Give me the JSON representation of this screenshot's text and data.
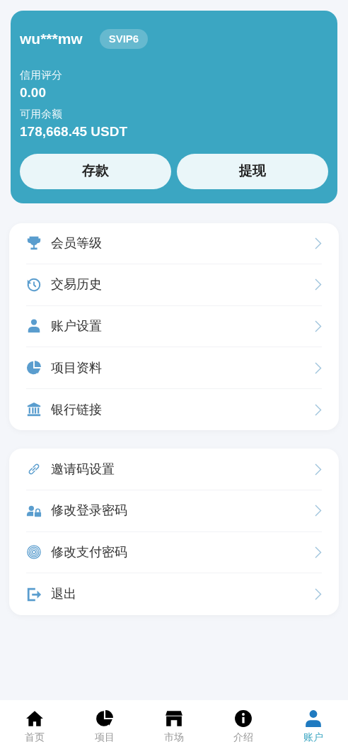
{
  "account": {
    "username": "wu***mw",
    "vip_badge": "SVIP6",
    "credit_label": "信用评分",
    "credit_value": "0.00",
    "balance_label": "可用余额",
    "balance_value": "178,668.45 USDT",
    "buttons": [
      "存款",
      "提现"
    ]
  },
  "menu_groups": [
    {
      "items": [
        {
          "label": "会员等级"
        },
        {
          "label": "交易历史"
        },
        {
          "label": "账户设置"
        },
        {
          "label": "项目资料"
        },
        {
          "label": "银行链接"
        }
      ]
    },
    {
      "items": [
        {
          "label": "邀请码设置"
        },
        {
          "label": "修改登录密码"
        },
        {
          "label": "修改支付密码"
        },
        {
          "label": "退出"
        }
      ]
    }
  ],
  "bottom_nav": [
    {
      "label": "首页",
      "selected": false
    },
    {
      "label": "项目",
      "selected": false
    },
    {
      "label": "市场",
      "selected": false
    },
    {
      "label": "介绍",
      "selected": false
    },
    {
      "label": "账户",
      "selected": true
    }
  ]
}
